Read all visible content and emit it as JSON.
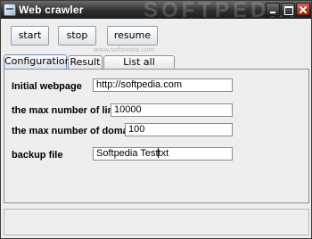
{
  "window": {
    "title": "Web crawler",
    "watermark": "SOFTPEDIA",
    "icon": "app-window-icon",
    "buttons": [
      "minimize-icon",
      "maximize-icon",
      "close-icon"
    ]
  },
  "toolbar": {
    "start_label": "start",
    "stop_label": "stop",
    "resume_label": "resume",
    "watermark_url": "www.softpedia.com"
  },
  "tabs": [
    {
      "label": "Configuration",
      "selected": true
    },
    {
      "label": "Result",
      "selected": false
    },
    {
      "label": "List all domains",
      "selected": false
    }
  ],
  "form": {
    "initial_webpage": {
      "label": "Initial webpage",
      "value": "http://softpedia.com"
    },
    "max_links": {
      "label": "the max number of links",
      "value": "10000"
    },
    "max_domains": {
      "label": "the max number of domains",
      "value": "100"
    },
    "backup_file": {
      "label": "backup file",
      "value_before_caret": "Softpedia Test",
      "value_after_caret": "txt"
    }
  }
}
